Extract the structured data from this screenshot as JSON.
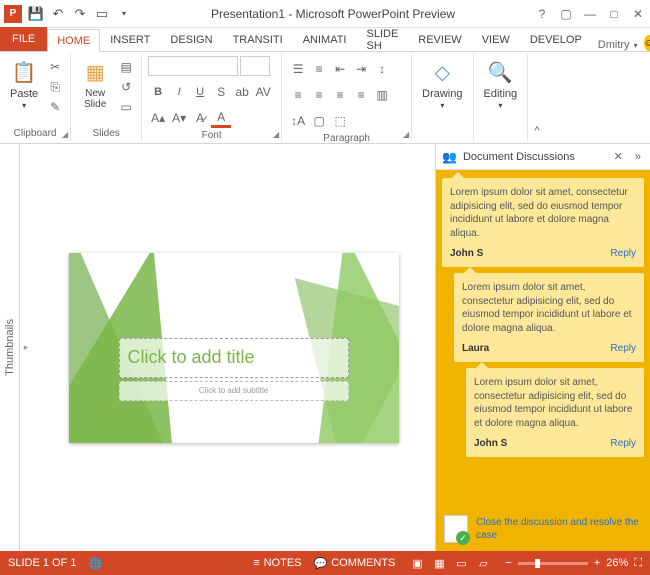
{
  "app": {
    "title": "Presentation1 - Microsoft PowerPoint Preview",
    "user": "Dmitry"
  },
  "tabs": {
    "file": "FILE",
    "home": "HOME",
    "insert": "INSERT",
    "design": "DESIGN",
    "transitions": "TRANSITI",
    "animations": "ANIMATI",
    "slideshow": "SLIDE SH",
    "review": "REVIEW",
    "view": "VIEW",
    "developer": "DEVELOP"
  },
  "ribbon": {
    "clipboard": {
      "paste": "Paste",
      "label": "Clipboard"
    },
    "slides": {
      "new": "New\nSlide",
      "label": "Slides"
    },
    "font": {
      "label": "Font"
    },
    "paragraph": {
      "label": "Paragraph"
    },
    "drawing": {
      "btn": "Drawing",
      "label": ""
    },
    "editing": {
      "btn": "Editing",
      "label": ""
    }
  },
  "thumbnails": {
    "label": "Thumbnails"
  },
  "slide": {
    "title_placeholder": "Click to add title",
    "subtitle_placeholder": "Click to add subtitle"
  },
  "discussions": {
    "title": "Document Discussions",
    "comments": [
      {
        "text": "Lorem ipsum dolor sit amet, consectetur adipisicing elit, sed do eiusmod tempor incididunt ut labore et dolore magna aliqua.",
        "author": "John S",
        "reply": "Reply",
        "indent": 0
      },
      {
        "text": "Lorem ipsum dolor sit amet, consectetur adipisicing elit, sed do eiusmod tempor incididunt ut labore et dolore magna aliqua.",
        "author": "Laura",
        "reply": "Reply",
        "indent": 1
      },
      {
        "text": "Lorem ipsum dolor sit amet, consectetur adipisicing elit, sed do eiusmod tempor incididunt ut labore et dolore magna aliqua.",
        "author": "John S",
        "reply": "Reply",
        "indent": 2
      }
    ],
    "close_link": "Close the discussion and resolve the case"
  },
  "statusbar": {
    "slide": "SLIDE 1 OF 1",
    "notes": "NOTES",
    "comments": "COMMENTS",
    "zoom": "26%"
  }
}
